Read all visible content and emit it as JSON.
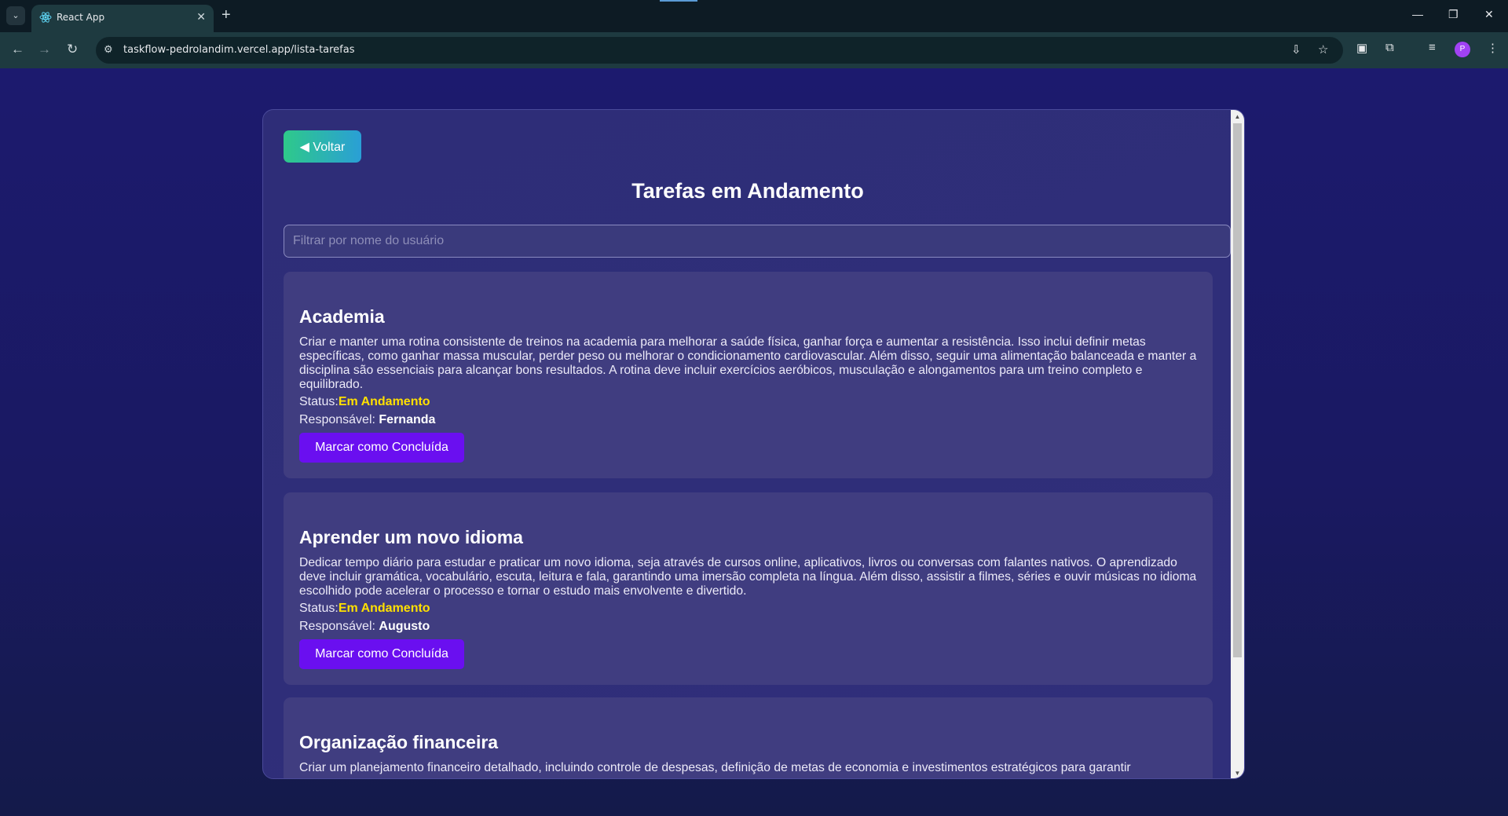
{
  "browser": {
    "tab_title": "React App",
    "url": "taskflow-pedrolandim.vercel.app/lista-tarefas",
    "profile_initial": "P",
    "icons": [
      "tab-list-icon",
      "react-logo-icon",
      "close-icon",
      "new-tab-icon",
      "back-icon",
      "forward-icon",
      "reload-icon",
      "site-info-icon",
      "install-icon",
      "star-icon",
      "translate-icon",
      "extensions-icon",
      "reading-list-icon",
      "menu-icon"
    ]
  },
  "page": {
    "back_label": "◀ Voltar",
    "title": "Tarefas em Andamento",
    "filter_placeholder": "Filtrar por nome do usuário",
    "status_label": "Status:",
    "responsible_label": "Responsável: ",
    "mark_done_label": "Marcar como Concluída",
    "tasks": [
      {
        "title": "Academia",
        "description": "Criar e manter uma rotina consistente de treinos na academia para melhorar a saúde física, ganhar força e aumentar a resistência. Isso inclui definir metas específicas, como ganhar massa muscular, perder peso ou melhorar o condicionamento cardiovascular. Além disso, seguir uma alimentação balanceada e manter a disciplina são essenciais para alcançar bons resultados. A rotina deve incluir exercícios aeróbicos, musculação e alongamentos para um treino completo e equilibrado.",
        "status": "Em Andamento",
        "responsible": "Fernanda"
      },
      {
        "title": "Aprender um novo idioma",
        "description": "Dedicar tempo diário para estudar e praticar um novo idioma, seja através de cursos online, aplicativos, livros ou conversas com falantes nativos. O aprendizado deve incluir gramática, vocabulário, escuta, leitura e fala, garantindo uma imersão completa na língua. Além disso, assistir a filmes, séries e ouvir músicas no idioma escolhido pode acelerar o processo e tornar o estudo mais envolvente e divertido.",
        "status": "Em Andamento",
        "responsible": "Augusto"
      },
      {
        "title": "Organização financeira",
        "description": "Criar um planejamento financeiro detalhado, incluindo controle de despesas, definição de metas de economia e investimentos estratégicos para garantir"
      }
    ]
  },
  "colors": {
    "status": "#ffe000",
    "primary_button": "#6a0ff0",
    "back_gradient_start": "#2ec98a",
    "back_gradient_end": "#2a9fd6"
  }
}
